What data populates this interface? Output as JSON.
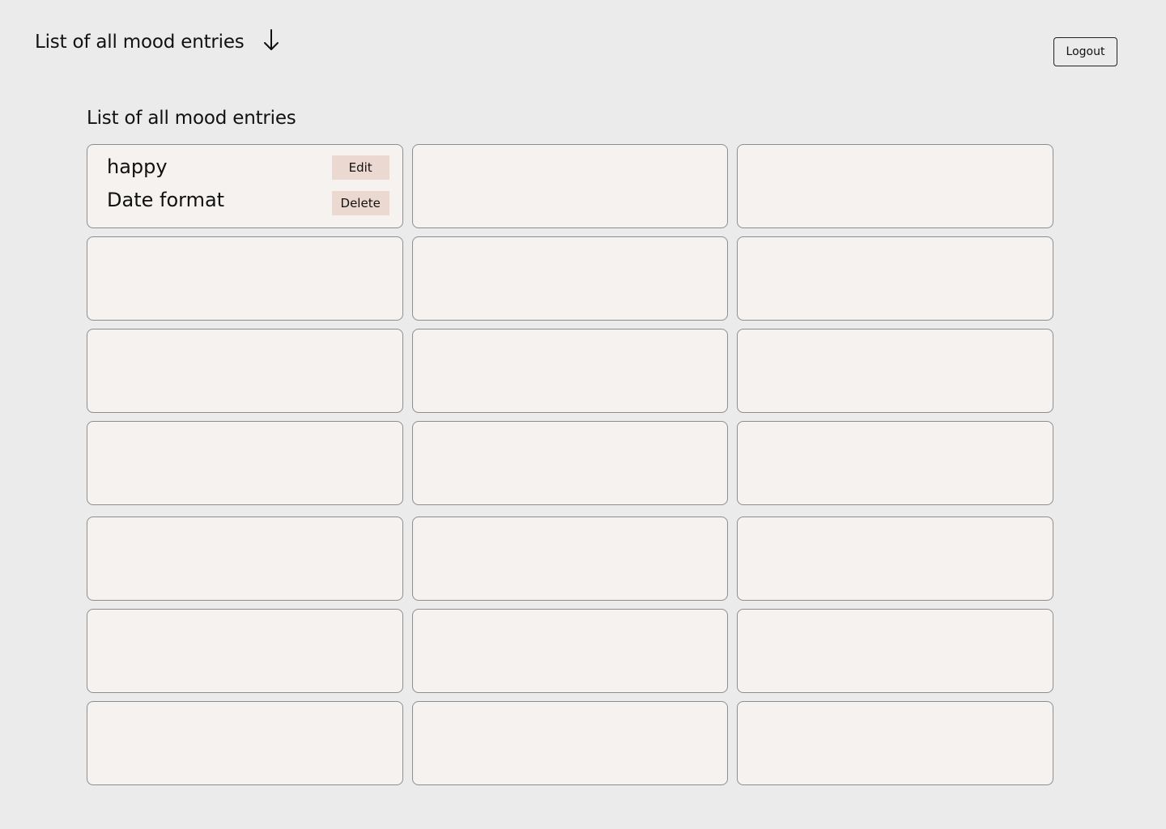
{
  "header": {
    "title": "List of all mood entries",
    "arrow_icon": "arrow-down-icon",
    "logout_label": "Logout"
  },
  "main": {
    "section_title": "List of all mood entries",
    "entries": [
      {
        "mood": "happy",
        "date": "Date format",
        "edit_label": "Edit",
        "delete_label": "Delete"
      }
    ]
  }
}
